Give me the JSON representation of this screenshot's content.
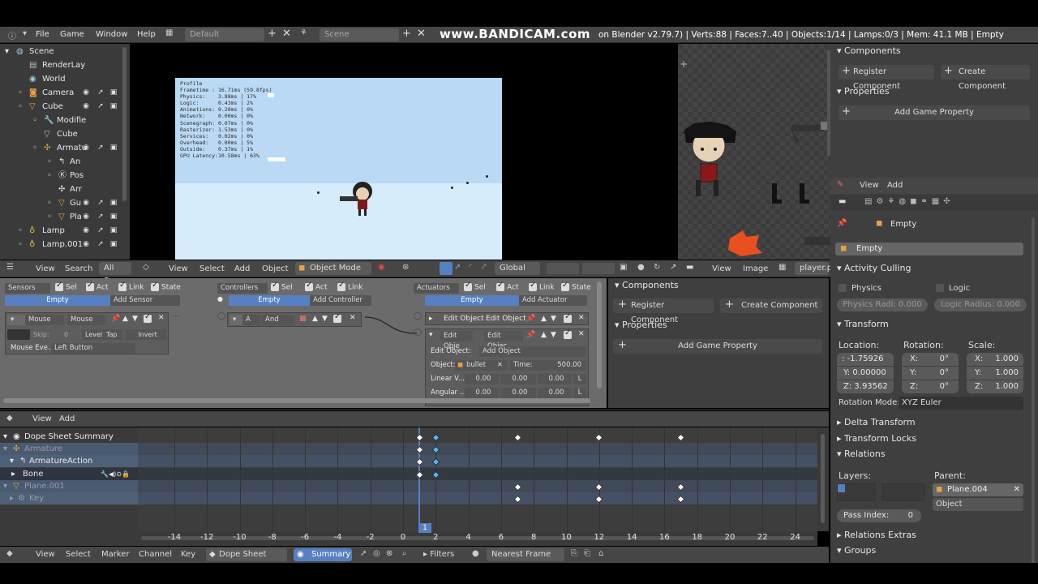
{
  "topbar": {
    "menus": [
      "File",
      "Game",
      "Window",
      "Help"
    ],
    "layout": "Default",
    "scene": "Scene",
    "watermark": "www.BANDICAM.com",
    "info": "on Blender v2.79.7) | Verts:88 | Faces:7..40 | Objects:1/14 | Lamps:0/3 | Mem: 41.1 MB | Empty"
  },
  "outliner": {
    "items": [
      "Scene",
      "RenderLay",
      "World",
      "Camera",
      "Cube",
      "Modifie",
      "Cube",
      "Armatu",
      "An",
      "Pos",
      "Arr",
      "Gu",
      "Pla",
      "Lamp",
      "Lamp.001"
    ]
  },
  "profile": {
    "title": "Profile",
    "lines": [
      "Frametime : 16.71ms (59.8fps)",
      "Physics:    3.88ms | 17%",
      "Logic:      0.43ms | 2%",
      "Animations: 0.20ms | 0%",
      "Network:    0.00ms | 0%",
      "Scenegraph: 0.07ms | 0%",
      "Rasterizer: 1.53ms | 0%",
      "Services:   0.02ms | 0%",
      "Overhead:   0.00ms | 5%",
      "Outside:    0.37ms | 1%",
      "GPU Latency:10.58ms | 63%"
    ]
  },
  "midbar": {
    "view": "View",
    "search": "Search",
    "allscenes": "All Scen",
    "view2": "View",
    "select": "Select",
    "add": "Add",
    "object": "Object",
    "mode": "Object Mode",
    "global": "Global",
    "view3": "View",
    "image": "Image",
    "player": "player.p"
  },
  "logic": {
    "sensors": {
      "title": "Sensors",
      "sel": "Sel",
      "act": "Act",
      "link": "Link",
      "state": "State",
      "object": "Empty",
      "add": "Add Sensor",
      "type": "Mouse",
      "name": "Mouse",
      "skip_label": "Skip:",
      "skip": "0",
      "level": "Level",
      "tap": "Tap",
      "invert": "Invert",
      "event_label": "Mouse Eve...",
      "event": "Left Button"
    },
    "controllers": {
      "title": "Controllers",
      "sel": "Sel",
      "act": "Act",
      "link": "Link",
      "object": "Empty",
      "add": "Add Controller",
      "type": "A",
      "name": "And"
    },
    "actuators": {
      "title": "Actuators",
      "sel": "Sel",
      "act": "Act",
      "link": "Link",
      "state": "State",
      "object": "Empty",
      "add": "Add Actuator",
      "a1_type": "Edit Object",
      "a1_name": "Edit Object",
      "a2_type": "Edit Obje",
      "a2_name": "Edit Objec...",
      "eo_label": "Edit Object:",
      "eo_value": "Add Object",
      "obj_label": "Object:",
      "obj_value": "bullet",
      "time_label": "Time:",
      "time_value": "500.00",
      "linv": "Linear V...",
      "angv": "Angular ...",
      "x": "0.00",
      "y": "0.00",
      "z": "0.00",
      "l": "L"
    }
  },
  "logicprops": {
    "components": "Components",
    "register": "Register Component",
    "create": "Create Component",
    "properties": "Properties",
    "addprop": "Add Game Property"
  },
  "right": {
    "components": "Components",
    "register": "Register Component",
    "create": "Create Component",
    "properties": "Properties",
    "addprop": "Add Game Property",
    "view": "View",
    "add": "Add",
    "objname": "Empty",
    "objfield": "Empty",
    "activity": "Activity Culling",
    "physics": "Physics",
    "logic": "Logic",
    "physradi": "Physics Radi: 0.000",
    "logicradius": "Logic Radius: 0.000",
    "transform": "Transform",
    "location": "Location:",
    "rotation": "Rotation:",
    "scale": "Scale:",
    "locx": "-1.75926",
    "locy": "Y: 0.00000",
    "locz": "Z: 3.93562",
    "rotx": "0°",
    "roty": "0°",
    "rotz": "0°",
    "sclx": "1.000",
    "scly": "1.000",
    "sclz": "1.000",
    "rotmode_label": "Rotation Mode:",
    "rotmode": "XYZ Euler",
    "delta": "Delta Transform",
    "locks": "Transform Locks",
    "relations": "Relations",
    "layers": "Layers:",
    "parent": "Parent:",
    "parent_value": "Plane.004",
    "parent_type": "Object",
    "passindex": "Pass Index:",
    "passvalue": "0",
    "relextras": "Relations Extras",
    "groups": "Groups"
  },
  "dope": {
    "view": "View",
    "add": "Add",
    "rows": [
      "Dope Sheet Summary",
      "Armature",
      "ArmatureAction",
      "Bone",
      "Plane.001",
      "Key"
    ],
    "ticks": [
      "-14",
      "-12",
      "-10",
      "-8",
      "-6",
      "-4",
      "-2",
      "0",
      "2",
      "4",
      "6",
      "8",
      "10",
      "12",
      "14",
      "16",
      "18",
      "20",
      "22",
      "24"
    ],
    "current_frame": "1",
    "bottom": {
      "view": "View",
      "select": "Select",
      "marker": "Marker",
      "channel": "Channel",
      "key": "Key",
      "mode": "Dope Sheet",
      "summary": "Summary",
      "filters": "Filters",
      "sync": "Nearest Frame"
    }
  },
  "colors": {
    "selected_key": "#5ab4ee",
    "playhead": "#5680c2"
  }
}
